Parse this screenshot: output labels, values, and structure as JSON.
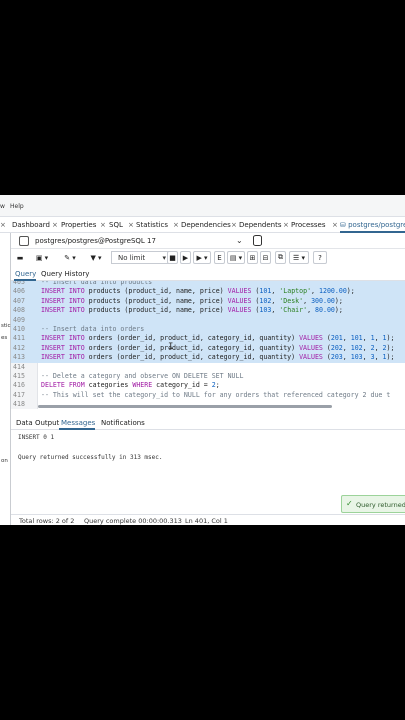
{
  "menubar": {
    "items": [
      "w",
      "Help"
    ]
  },
  "tabs": [
    {
      "label": "Dashboard"
    },
    {
      "label": "Properties"
    },
    {
      "label": "SQL"
    },
    {
      "label": "Statistics"
    },
    {
      "label": "Dependencies"
    },
    {
      "label": "Dependents"
    },
    {
      "label": "Processes"
    },
    {
      "label": "postgres/postgres@"
    }
  ],
  "tab_close": "×",
  "sidebar_fragments": [
    "stic",
    "es",
    "on"
  ],
  "connection": {
    "label": "postgres/postgres@PostgreSQL 17"
  },
  "toolbar": {
    "limit": "No limit"
  },
  "query_tabs": [
    "Query",
    "Query History"
  ],
  "editor": {
    "lines": [
      {
        "n": "405",
        "code": "-- Insert data into products"
      },
      {
        "n": "406",
        "code": "INSERT INTO products (product_id, name, price) VALUES (101, 'Laptop', 1200.00);"
      },
      {
        "n": "407",
        "code": "INSERT INTO products (product_id, name, price) VALUES (102, 'Desk', 300.00);"
      },
      {
        "n": "408",
        "code": "INSERT INTO products (product_id, name, price) VALUES (103, 'Chair', 80.00);"
      },
      {
        "n": "409",
        "code": ""
      },
      {
        "n": "410",
        "code": "-- Insert data into orders"
      },
      {
        "n": "411",
        "code": "INSERT INTO orders (order_id, product_id, category_id, quantity) VALUES (201, 101, 1, 1);"
      },
      {
        "n": "412",
        "code": "INSERT INTO orders (order_id, product_id, category_id, quantity) VALUES (202, 102, 2, 2);"
      },
      {
        "n": "413",
        "code": "INSERT INTO orders (order_id, product_id, category_id, quantity) VALUES (203, 103, 3, 1);"
      },
      {
        "n": "414",
        "code": ""
      },
      {
        "n": "415",
        "code": "-- Delete a category and observe ON DELETE SET NULL"
      },
      {
        "n": "416",
        "code": "DELETE FROM categories WHERE category_id = 2;"
      },
      {
        "n": "417",
        "code": "-- This will set the category_id to NULL for any orders that referenced category 2 due t"
      },
      {
        "n": "418",
        "code": ""
      }
    ]
  },
  "result_tabs": [
    "Data Output",
    "Messages",
    "Notifications"
  ],
  "messages": {
    "line1": "INSERT 0 1",
    "line2": "Query returned successfully in 313 msec."
  },
  "toast": {
    "text": "Query returned s"
  },
  "status": {
    "total_rows": "Total rows: 2 of 2",
    "query_complete": "Query complete 00:00:00.313",
    "position": "Ln 401, Col 1"
  }
}
